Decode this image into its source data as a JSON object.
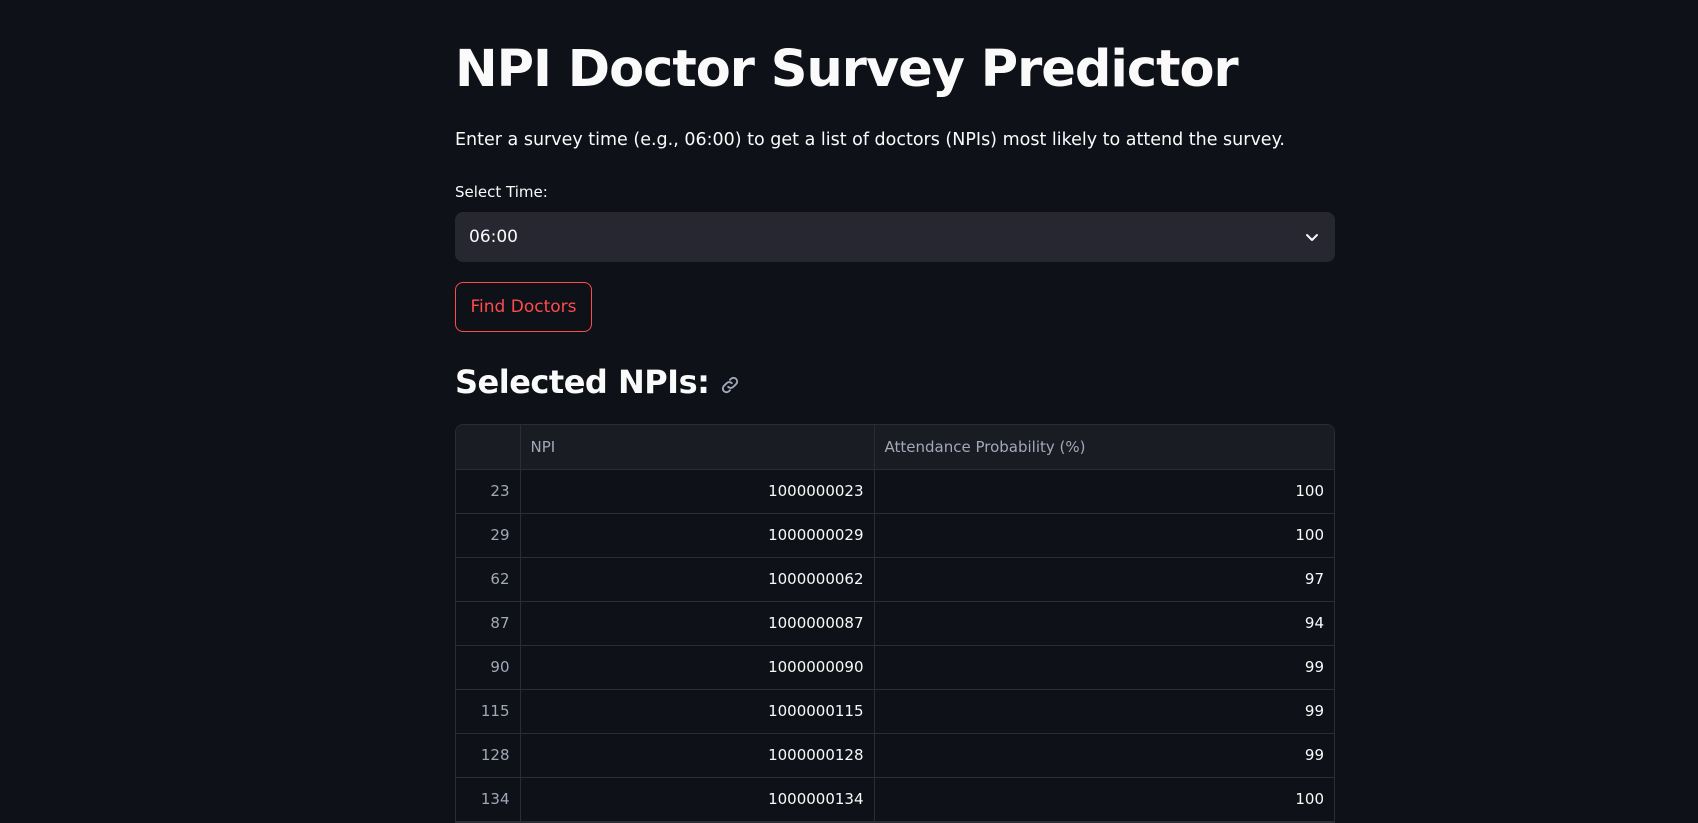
{
  "header": {
    "title": "NPI Doctor Survey Predictor",
    "description": "Enter a survey time (e.g., 06:00) to get a list of doctors (NPIs) most likely to attend the survey."
  },
  "time_select": {
    "label": "Select Time:",
    "value": "06:00"
  },
  "find_button": {
    "label": "Find Doctors"
  },
  "results": {
    "heading": "Selected NPIs:",
    "columns": [
      "",
      "NPI",
      "Attendance Probability (%)"
    ],
    "rows": [
      {
        "index": "23",
        "npi": "1000000023",
        "prob": "100"
      },
      {
        "index": "29",
        "npi": "1000000029",
        "prob": "100"
      },
      {
        "index": "62",
        "npi": "1000000062",
        "prob": "97"
      },
      {
        "index": "87",
        "npi": "1000000087",
        "prob": "94"
      },
      {
        "index": "90",
        "npi": "1000000090",
        "prob": "99"
      },
      {
        "index": "115",
        "npi": "1000000115",
        "prob": "99"
      },
      {
        "index": "128",
        "npi": "1000000128",
        "prob": "99"
      },
      {
        "index": "134",
        "npi": "1000000134",
        "prob": "100"
      }
    ]
  },
  "colors": {
    "background": "#0e1117",
    "accent": "#ff4b4b",
    "input_bg": "#262730"
  },
  "icons": {
    "select_chevron": "chevron-down-icon",
    "heading_anchor": "link-icon"
  }
}
